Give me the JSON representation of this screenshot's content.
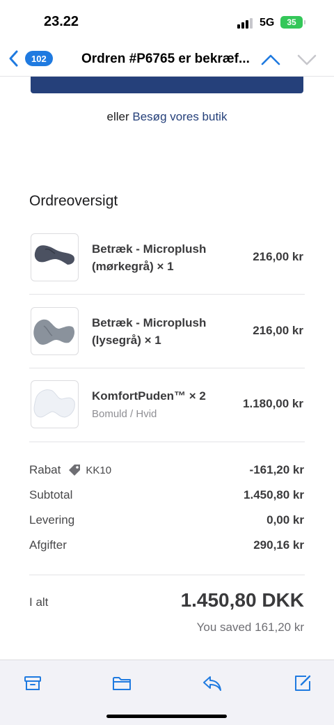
{
  "status_bar": {
    "time": "23.22",
    "network": "5G",
    "battery": "35"
  },
  "nav": {
    "back_count": "102",
    "title": "Ordren #P6765 er bekræf..."
  },
  "content": {
    "alt_prefix": "eller",
    "alt_link": "Besøg vores butik",
    "section_title": "Ordreoversigt",
    "items": [
      {
        "name": "Betræk - Microplush (mørkegrå) × 1",
        "sub": "",
        "price": "216,00 kr",
        "color": "#4b5161"
      },
      {
        "name": "Betræk - Microplush (lysegrå) × 1",
        "sub": "",
        "price": "216,00 kr",
        "color": "#8a929c"
      },
      {
        "name": "KomfortPuden™ × 2",
        "sub": "Bomuld / Hvid",
        "price": "1.180,00 kr",
        "color": "#eef1f6"
      }
    ],
    "summary": {
      "discount_label": "Rabat",
      "discount_code": "KK10",
      "discount_value": "-161,20 kr",
      "subtotal_label": "Subtotal",
      "subtotal_value": "1.450,80 kr",
      "shipping_label": "Levering",
      "shipping_value": "0,00 kr",
      "taxes_label": "Afgifter",
      "taxes_value": "290,16 kr"
    },
    "total": {
      "label": "I alt",
      "value": "1.450,80 DKK",
      "saved_label": "You saved",
      "saved_value": "161,20 kr"
    }
  },
  "toolbar": {
    "archive": "archive-icon",
    "folder": "folder-icon",
    "reply": "reply-icon",
    "compose": "compose-icon"
  },
  "colors": {
    "accent": "#1f7ae0",
    "brand": "#25407a",
    "battery": "#34c759"
  }
}
